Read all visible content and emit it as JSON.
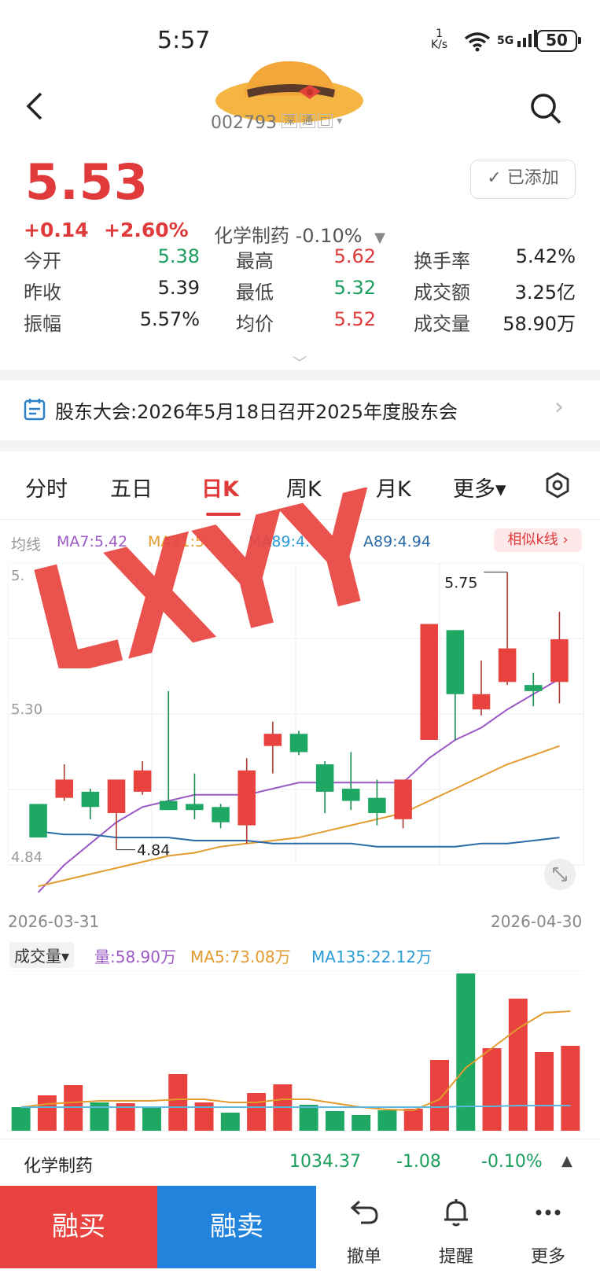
{
  "status_bar": {
    "time": "5:57",
    "net_speed_top": "1",
    "net_speed_unit": "K/s",
    "network": "5G",
    "battery": "50"
  },
  "header": {
    "stock_code": "002793",
    "tags": [
      "深",
      "通",
      "□"
    ]
  },
  "quote": {
    "price": "5.53",
    "change": "+0.14",
    "change_pct": "+2.60%",
    "sector": "化学制药 -0.10%",
    "added_label": "✓ 已添加",
    "stats": [
      {
        "label": "今开",
        "value": "5.38",
        "color": "#1a9e5c"
      },
      {
        "label": "最高",
        "value": "5.62",
        "color": "#e03a3a"
      },
      {
        "label": "换手率",
        "value": "5.42%",
        "color": "#222222"
      },
      {
        "label": "昨收",
        "value": "5.39",
        "color": "#222222"
      },
      {
        "label": "最低",
        "value": "5.32",
        "color": "#1a9e5c"
      },
      {
        "label": "成交额",
        "value": "3.25亿",
        "color": "#222222"
      },
      {
        "label": "振幅",
        "value": "5.57%",
        "color": "#222222"
      },
      {
        "label": "均价",
        "value": "5.52",
        "color": "#e03a3a"
      },
      {
        "label": "成交量",
        "value": "58.90万",
        "color": "#222222"
      }
    ]
  },
  "banner": {
    "text": "股东大会:2026年5月18日召开2025年度股东会"
  },
  "tabs": [
    "分时",
    "五日",
    "日K",
    "周K",
    "月K",
    "更多▾"
  ],
  "ma_legend": {
    "prefix": "均线",
    "ma7": "MA7:5.42",
    "ma21": "MA21:5.",
    "ma89a": "MA89:4.",
    "ma89b": "A89:4.94",
    "similar": "相似k线 ›"
  },
  "chart_data": [
    {
      "type": "candlestick",
      "title": "",
      "x_start": "2026-03-31",
      "x_end": "2026-04-30",
      "y_tick_labels": [
        "5.",
        "5.30",
        "4.84"
      ],
      "ylim": [
        4.79,
        5.78
      ],
      "annotations": {
        "max_label": "5.75",
        "min_label": "4.84"
      },
      "candles": [
        {
          "o": 4.99,
          "c": 4.88,
          "h": 4.99,
          "l": 4.88
        },
        {
          "o": 5.01,
          "c": 5.07,
          "h": 5.12,
          "l": 5.0
        },
        {
          "o": 5.03,
          "c": 4.98,
          "h": 5.04,
          "l": 4.94
        },
        {
          "o": 4.96,
          "c": 5.07,
          "h": 5.07,
          "l": 4.84
        },
        {
          "o": 5.03,
          "c": 5.1,
          "h": 5.13,
          "l": 5.02
        },
        {
          "o": 5.0,
          "c": 4.97,
          "h": 5.36,
          "l": 4.97
        },
        {
          "o": 4.99,
          "c": 4.97,
          "h": 5.09,
          "l": 4.94
        },
        {
          "o": 4.98,
          "c": 4.93,
          "h": 4.99,
          "l": 4.91
        },
        {
          "o": 4.92,
          "c": 5.1,
          "h": 5.14,
          "l": 4.86
        },
        {
          "o": 5.18,
          "c": 5.22,
          "h": 5.26,
          "l": 5.09
        },
        {
          "o": 5.22,
          "c": 5.16,
          "h": 5.23,
          "l": 5.15
        },
        {
          "o": 5.12,
          "c": 5.03,
          "h": 5.13,
          "l": 4.96
        },
        {
          "o": 5.04,
          "c": 5.0,
          "h": 5.16,
          "l": 4.97
        },
        {
          "o": 5.01,
          "c": 4.96,
          "h": 5.07,
          "l": 4.92
        },
        {
          "o": 4.94,
          "c": 5.07,
          "h": 5.07,
          "l": 4.91
        },
        {
          "o": 5.2,
          "c": 5.58,
          "h": 5.58,
          "l": 5.2
        },
        {
          "o": 5.56,
          "c": 5.35,
          "h": 5.56,
          "l": 5.2
        },
        {
          "o": 5.3,
          "c": 5.35,
          "h": 5.46,
          "l": 5.28
        },
        {
          "o": 5.39,
          "c": 5.5,
          "h": 5.75,
          "l": 5.38
        },
        {
          "o": 5.38,
          "c": 5.36,
          "h": 5.42,
          "l": 5.31
        },
        {
          "o": 5.39,
          "c": 5.53,
          "h": 5.62,
          "l": 5.32
        }
      ],
      "ma_lines": [
        {
          "name": "MA7",
          "color": "#9b59c6",
          "values": [
            4.7,
            4.79,
            4.86,
            4.93,
            4.98,
            5.0,
            5.02,
            5.02,
            5.02,
            5.04,
            5.06,
            5.06,
            5.06,
            5.06,
            5.06,
            5.14,
            5.2,
            5.24,
            5.3,
            5.35,
            5.4
          ]
        },
        {
          "name": "MA21",
          "color": "#e39b2e",
          "values": [
            4.72,
            4.74,
            4.76,
            4.78,
            4.8,
            4.82,
            4.83,
            4.85,
            4.86,
            4.87,
            4.88,
            4.9,
            4.92,
            4.94,
            4.96,
            5.0,
            5.04,
            5.08,
            5.12,
            5.15,
            5.18
          ]
        },
        {
          "name": "MA89",
          "color": "#2a6aa8",
          "values": [
            4.9,
            4.89,
            4.89,
            4.88,
            4.88,
            4.88,
            4.87,
            4.87,
            4.87,
            4.86,
            4.86,
            4.86,
            4.86,
            4.85,
            4.85,
            4.85,
            4.85,
            4.86,
            4.86,
            4.87,
            4.88
          ]
        }
      ]
    },
    {
      "type": "bar",
      "title": "",
      "legend": {
        "selector": "成交量▾",
        "vol": "量:58.90万",
        "ma5": "MA5:73.08万",
        "ma135": "MA135:22.12万"
      },
      "values": [
        30,
        45,
        58,
        36,
        35,
        30,
        72,
        36,
        23,
        48,
        59,
        33,
        25,
        20,
        26,
        28,
        90,
        200,
        105,
        168,
        100,
        108
      ],
      "colors": [
        "g",
        "r",
        "r",
        "g",
        "r",
        "g",
        "r",
        "r",
        "g",
        "r",
        "r",
        "g",
        "g",
        "g",
        "g",
        "r",
        "r",
        "g",
        "r",
        "r",
        "r",
        "r"
      ],
      "ma5": [
        30,
        34,
        36,
        38,
        38,
        38,
        40,
        40,
        36,
        36,
        40,
        40,
        35,
        30,
        27,
        26,
        40,
        80,
        105,
        130,
        150,
        152
      ],
      "ma135": [
        30,
        30,
        30,
        30,
        30,
        30,
        30,
        30,
        30,
        30,
        30,
        30,
        30,
        30,
        30,
        30,
        30,
        31,
        31,
        32,
        32,
        32
      ]
    }
  ],
  "sector_bar": {
    "name": "化学制药",
    "value": "1034.37",
    "change": "-1.08",
    "pct": "-0.10%"
  },
  "bottom": {
    "buy": "融买",
    "sell": "融卖",
    "cancel": "撤单",
    "alert": "提醒",
    "more": "更多"
  },
  "watermark": "LXYY"
}
